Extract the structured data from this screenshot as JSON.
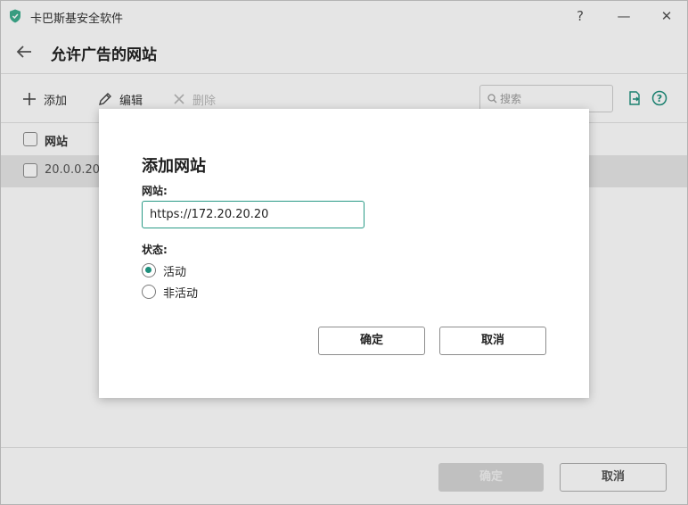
{
  "window": {
    "title": "卡巴斯基安全软件"
  },
  "titlebar": {
    "help": "?",
    "minimize": "—",
    "close": "✕"
  },
  "page": {
    "title": "允许广告的网站"
  },
  "toolbar": {
    "add": "添加",
    "edit": "编辑",
    "delete": "删除",
    "search_placeholder": "搜索"
  },
  "table": {
    "column": "网站",
    "rows": [
      "20.0.0.20"
    ]
  },
  "footer": {
    "ok": "确定",
    "cancel": "取消"
  },
  "dialog": {
    "title": "添加网站",
    "site_label": "网站:",
    "site_value": "https://172.20.20.20",
    "status_label": "状态:",
    "options": [
      {
        "label": "活动",
        "checked": true
      },
      {
        "label": "非活动",
        "checked": false
      }
    ],
    "ok": "确定",
    "cancel": "取消"
  },
  "colors": {
    "accent": "#1e8f7c",
    "input_border": "#2a9a86"
  },
  "icons": [
    "shield-logo-icon",
    "back-arrow-icon",
    "plus-icon",
    "pencil-icon",
    "x-icon",
    "search-icon",
    "export-icon",
    "help-circle-icon"
  ]
}
